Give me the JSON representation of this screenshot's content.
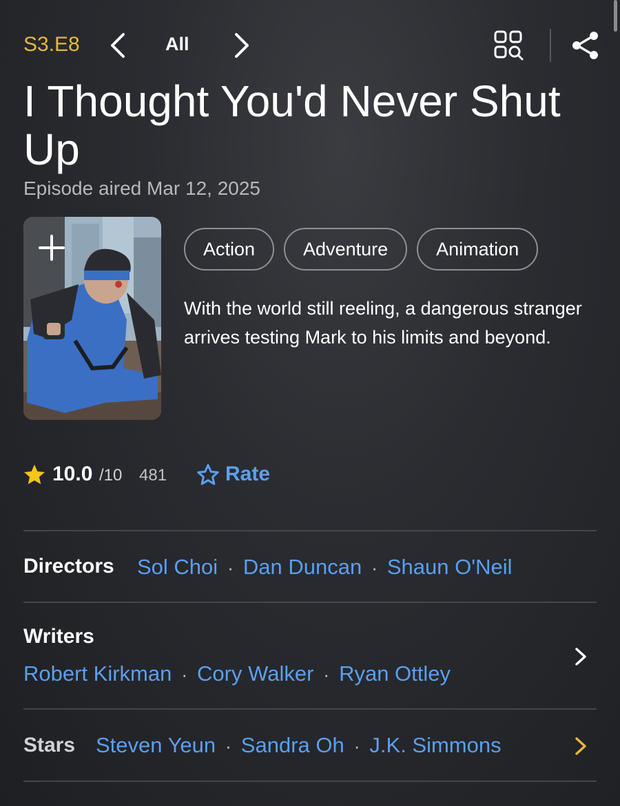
{
  "header": {
    "episode_code": "S3.E8",
    "filter_label": "All"
  },
  "episode": {
    "title": "I Thought You'd Never Shut Up",
    "aired": "Episode aired Mar 12, 2025",
    "genres": [
      "Action",
      "Adventure",
      "Animation"
    ],
    "plot": "With the world still reeling, a dangerous stranger arrives testing Mark to his limits and beyond."
  },
  "rating": {
    "value": "10.0",
    "max": "/10",
    "count": "481",
    "rate_label": "Rate"
  },
  "credits": {
    "directors": {
      "label": "Directors",
      "names": [
        "Sol Choi",
        "Dan Duncan",
        "Shaun O'Neil"
      ]
    },
    "writers": {
      "label": "Writers",
      "names": [
        "Robert Kirkman",
        "Cory Walker",
        "Ryan Ottley"
      ]
    },
    "stars": {
      "label": "Stars",
      "names": [
        "Steven Yeun",
        "Sandra Oh",
        "J.K. Simmons"
      ]
    }
  },
  "colors": {
    "accent_gold": "#e8b73a",
    "link_blue": "#5b9fef",
    "background": "#2a2c31"
  },
  "icons": {
    "prev": "chevron-left-icon",
    "next": "chevron-right-icon",
    "grid": "grid-search-icon",
    "share": "share-icon",
    "add": "plus-icon",
    "star": "star-filled-icon",
    "rate": "star-outline-icon"
  }
}
